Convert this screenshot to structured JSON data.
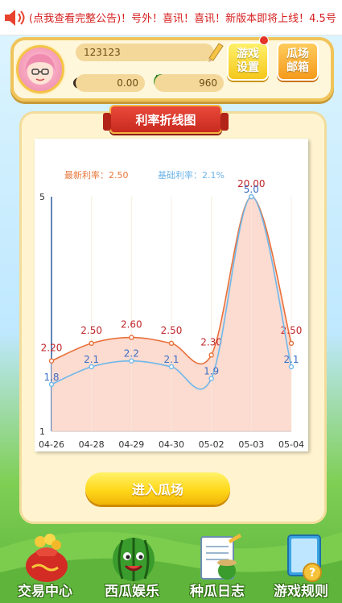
{
  "marquee": {
    "link_text": "(点我查看完整公告)",
    "message": "！号外！喜讯！喜讯！新版本即将上线！4.5号"
  },
  "user": {
    "name": "123123",
    "coins": "0.00",
    "melons": "960"
  },
  "header_buttons": {
    "settings_line1": "游戏",
    "settings_line2": "设置",
    "mail_line1": "瓜场",
    "mail_line2": "邮箱"
  },
  "panel_title": "利率折线图",
  "legend": {
    "latest": "最新利率：2.50",
    "base": "基础利率：2.1%"
  },
  "chart_data": {
    "type": "line",
    "categories": [
      "04-26",
      "04-28",
      "04-29",
      "04-30",
      "05-02",
      "05-03",
      "05-04"
    ],
    "y_ticks": [
      "1",
      "5"
    ],
    "ylim": [
      1,
      5
    ],
    "series": [
      {
        "values": [
          2.2,
          2.5,
          2.6,
          2.5,
          2.3,
          5.0,
          2.5
        ],
        "labels": [
          "2.20",
          "2.50",
          "2.60",
          "2.50",
          "2.30",
          "20.00",
          "2.50"
        ],
        "color": "#e8703a",
        "label_color": "#c0262b"
      },
      {
        "values": [
          1.8,
          2.1,
          2.2,
          2.1,
          1.9,
          5.0,
          2.1
        ],
        "labels": [
          "1.8",
          "2.1",
          "2.2",
          "2.1",
          "1.9",
          "5.0",
          "2.1"
        ],
        "color": "#6eb8ea",
        "label_color": "#3b6fc6"
      }
    ],
    "grid": true,
    "area_fill": "#fbd5c8"
  },
  "enter_button": "进入瓜场",
  "nav": [
    {
      "label": "交易中心",
      "icon": "money-bag-icon"
    },
    {
      "label": "西瓜娱乐",
      "icon": "watermelon-icon"
    },
    {
      "label": "种瓜日志",
      "icon": "notebook-icon"
    },
    {
      "label": "游戏规则",
      "icon": "rules-book-icon"
    }
  ]
}
